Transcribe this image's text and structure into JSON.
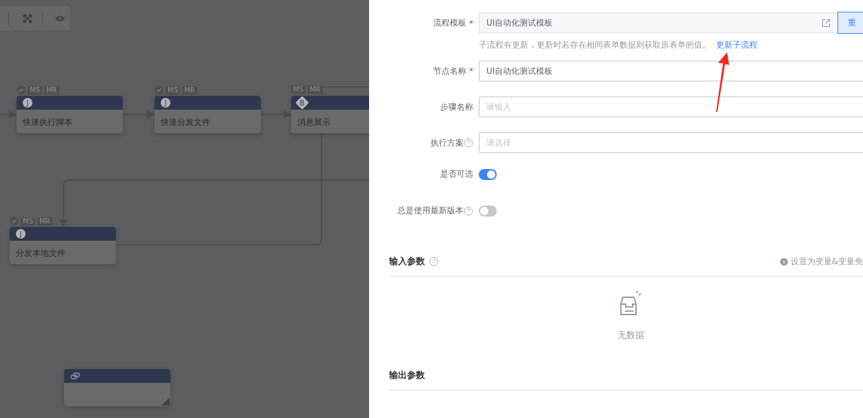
{
  "canvas": {
    "nodes": [
      {
        "icon": "J",
        "title": "快速执行脚本",
        "badges": [
          "MS",
          "MR"
        ],
        "checked": true,
        "kind": "task"
      },
      {
        "icon": "J",
        "title": "快速分发文件",
        "badges": [
          "MS",
          "MR"
        ],
        "checked": true,
        "kind": "task"
      },
      {
        "icon": "B",
        "title": "消息展示",
        "badges": [
          "MS",
          "MR"
        ],
        "checked": false,
        "kind": "branch"
      },
      {
        "icon": "J",
        "title": "分发本地文件",
        "badges": [
          "MS",
          "MR"
        ],
        "checked": true,
        "kind": "task"
      },
      {
        "kind": "note"
      }
    ]
  },
  "form": {
    "fields": [
      {
        "kind": "template",
        "label": "流程模板",
        "required_mark": "*",
        "value": "UI自动化测试模板",
        "button": "重",
        "hint": "子流程有更新，更新时若存在相同表单数据则获取原表单的值。",
        "hint_link": "更新子流程"
      },
      {
        "kind": "input",
        "label": "节点名称",
        "required_mark": "*",
        "value": "UI自动化测试模板"
      },
      {
        "kind": "input",
        "label": "步骤名称",
        "placeholder": "请输入"
      },
      {
        "kind": "select",
        "label": "执行方案",
        "help": true,
        "placeholder": "请选择"
      },
      {
        "kind": "switch",
        "label": "是否可选",
        "on": true
      },
      {
        "kind": "switch",
        "label": "总是使用最新版本",
        "help": true,
        "on": false
      }
    ]
  },
  "input_params": {
    "title": "输入参数",
    "tip": "设置为变量&变量免",
    "empty": "无数据"
  },
  "output_params": {
    "title": "输出参数"
  }
}
